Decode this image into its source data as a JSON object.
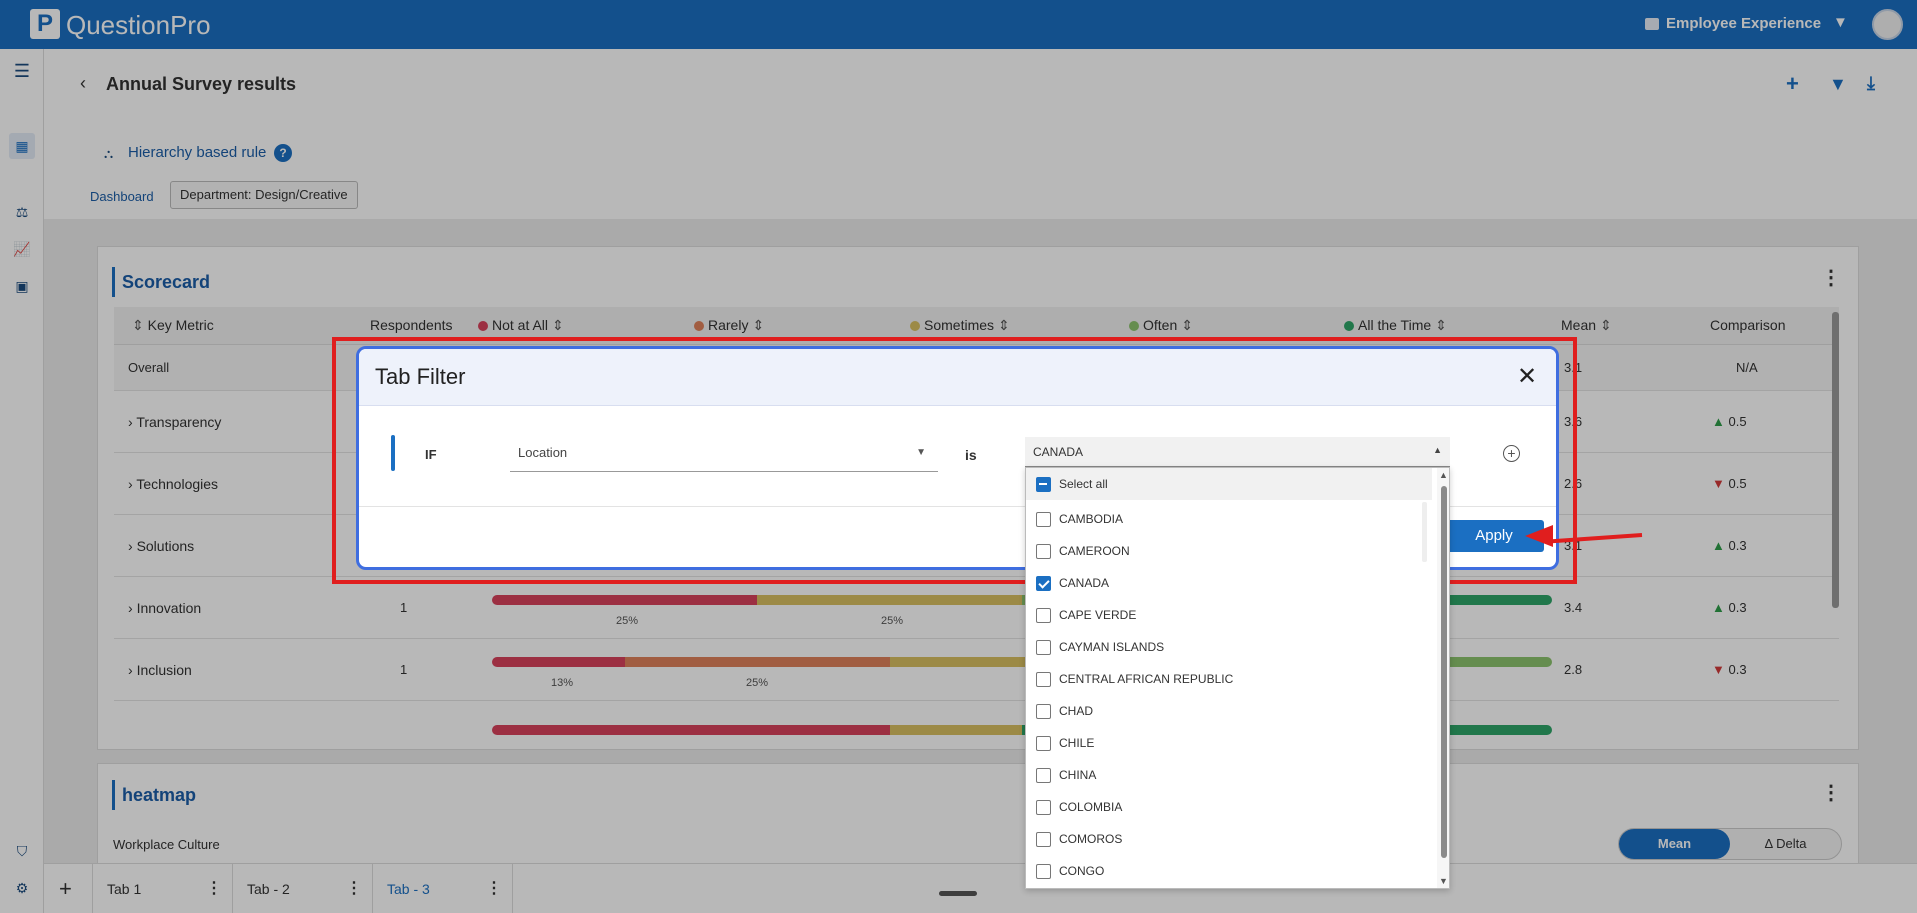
{
  "app": {
    "logo_letter": "P",
    "name": "QuestionPro",
    "product": "Employee Experience"
  },
  "page": {
    "title": "Annual Survey results",
    "rule_label": "Hierarchy based rule",
    "help": "?"
  },
  "breadcrumb": {
    "root": "Dashboard",
    "filter_chip": "Department: Design/Creative"
  },
  "scorecard": {
    "title": "Scorecard",
    "columns": [
      "Key Metric",
      "Respondents",
      "Not at All",
      "Rarely",
      "Sometimes",
      "Often",
      "All the Time",
      "Mean",
      "Comparison"
    ],
    "rows": [
      {
        "label": "Overall",
        "respondents": "",
        "mean": "3.1",
        "comparison": "N/A"
      },
      {
        "label": "Transparency",
        "respondents": "",
        "mean": "3.6",
        "comparison": "0.5",
        "trend": "up"
      },
      {
        "label": "Technologies",
        "respondents": "",
        "mean": "2.6",
        "comparison": "0.5",
        "trend": "down"
      },
      {
        "label": "Solutions",
        "respondents": "",
        "mean": "3.1",
        "comparison": "0.3",
        "trend": "up"
      },
      {
        "label": "Innovation",
        "respondents": "1",
        "mean": "3.4",
        "comparison": "0.3",
        "trend": "up",
        "pct1": "25%",
        "pct2": "25%"
      },
      {
        "label": "Inclusion",
        "respondents": "1",
        "mean": "2.8",
        "comparison": "0.3",
        "trend": "down",
        "pct1": "13%",
        "pct2": "25%"
      }
    ]
  },
  "heatmap": {
    "title": "heatmap",
    "subtitle": "Workplace Culture",
    "toggle_on": "Mean",
    "toggle_off": "Δ Delta"
  },
  "tabs": [
    {
      "label": "Tab 1"
    },
    {
      "label": "Tab - 2"
    },
    {
      "label": "Tab - 3",
      "active": true
    }
  ],
  "modal": {
    "title": "Tab Filter",
    "if_label": "IF",
    "field": "Location",
    "operator": "is",
    "value": "CANADA",
    "apply": "Apply"
  },
  "dropdown": {
    "select_all": "Select all",
    "options": [
      {
        "label": "CAMBODIA",
        "checked": false
      },
      {
        "label": "CAMEROON",
        "checked": false
      },
      {
        "label": "CANADA",
        "checked": true
      },
      {
        "label": "CAPE VERDE",
        "checked": false
      },
      {
        "label": "CAYMAN ISLANDS",
        "checked": false
      },
      {
        "label": "CENTRAL AFRICAN REPUBLIC",
        "checked": false
      },
      {
        "label": "CHAD",
        "checked": false
      },
      {
        "label": "CHILE",
        "checked": false
      },
      {
        "label": "CHINA",
        "checked": false
      },
      {
        "label": "COLOMBIA",
        "checked": false
      },
      {
        "label": "COMOROS",
        "checked": false
      },
      {
        "label": "CONGO",
        "checked": false
      }
    ]
  },
  "colors": {
    "brand": "#1b6fc2",
    "annotation": "#e01e1e",
    "not_at_all": "#d9425c",
    "rarely": "#e0825a",
    "sometimes": "#d9c062",
    "often": "#8cc46e",
    "all_the_time": "#2ea568"
  }
}
